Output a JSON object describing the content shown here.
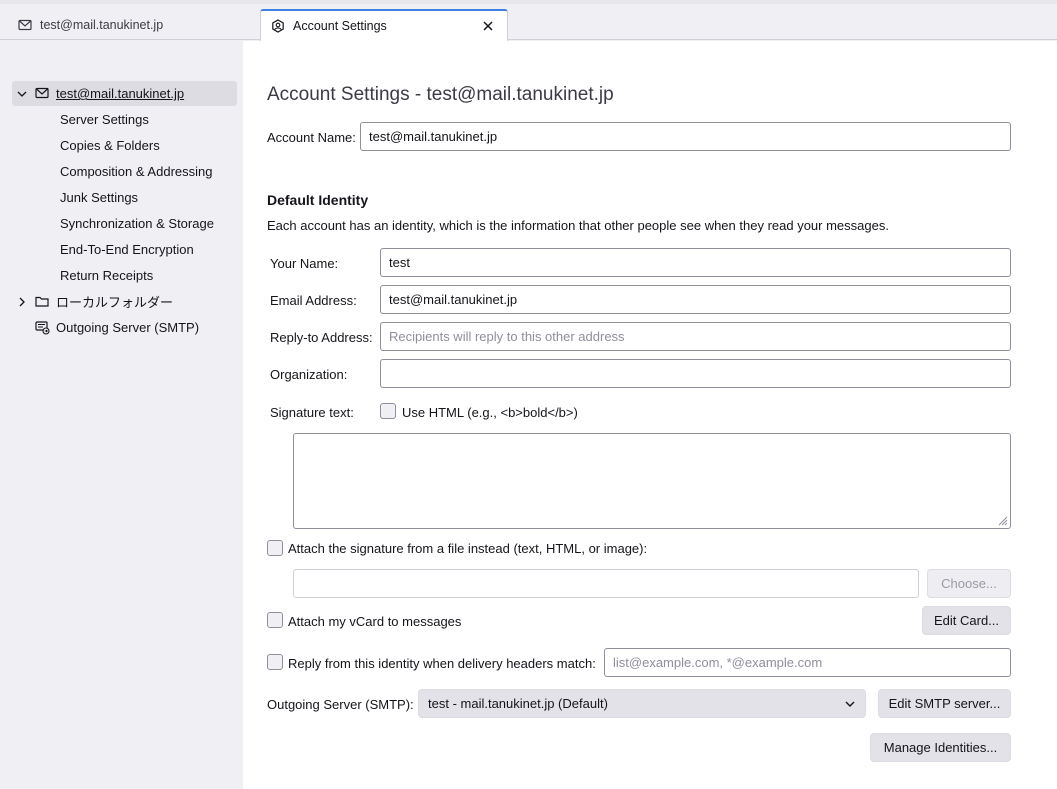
{
  "tabs": {
    "inactive_label": "test@mail.tanukinet.jp",
    "active_label": "Account Settings"
  },
  "sidebar": {
    "account": "test@mail.tanukinet.jp",
    "sub_items": [
      "Server Settings",
      "Copies & Folders",
      "Composition & Addressing",
      "Junk Settings",
      "Synchronization & Storage",
      "End-To-End Encryption",
      "Return Receipts"
    ],
    "local_folders": "ローカルフォルダー",
    "outgoing_server": "Outgoing Server (SMTP)"
  },
  "main": {
    "title": "Account Settings - test@mail.tanukinet.jp",
    "account_name_label": "Account Name:",
    "account_name_value": "test@mail.tanukinet.jp",
    "default_identity_heading": "Default Identity",
    "identity_description": "Each account has an identity, which is the information that other people see when they read your messages.",
    "your_name_label": "Your Name:",
    "your_name_value": "test",
    "email_label": "Email Address:",
    "email_value": "test@mail.tanukinet.jp",
    "reply_to_label": "Reply-to Address:",
    "reply_to_placeholder": "Recipients will reply to this other address",
    "organization_label": "Organization:",
    "organization_value": "",
    "signature_label": "Signature text:",
    "use_html_label": "Use HTML (e.g., <b>bold</b>)",
    "attach_sig_label": "Attach the signature from a file instead (text, HTML, or image):",
    "choose_button": "Choose...",
    "attach_vcard_label": "Attach my vCard to messages",
    "edit_card_button": "Edit Card...",
    "reply_from_label": "Reply from this identity when delivery headers match:",
    "reply_from_placeholder": "list@example.com, *@example.com",
    "smtp_label": "Outgoing Server (SMTP):",
    "smtp_value": "test - mail.tanukinet.jp (Default)",
    "edit_smtp_button": "Edit SMTP server...",
    "manage_identities_button": "Manage Identities..."
  }
}
